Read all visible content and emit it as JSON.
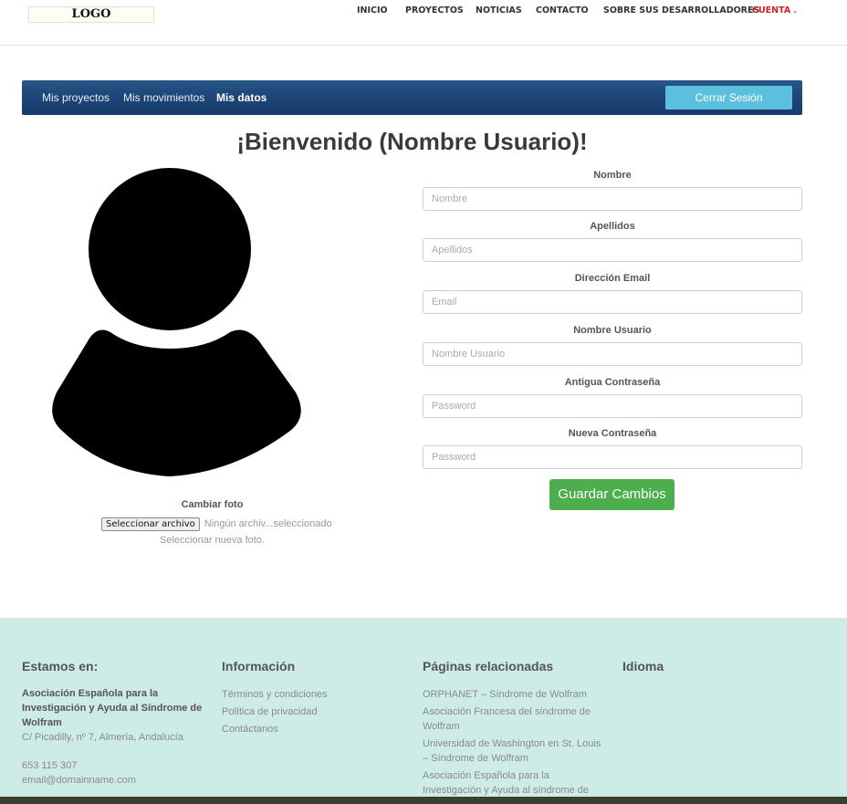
{
  "header": {
    "logo": "LOGO",
    "nav": [
      {
        "label": "INICIO",
        "active": false
      },
      {
        "label": "PROYECTOS",
        "active": false
      },
      {
        "label": "NOTICIAS",
        "active": false
      },
      {
        "label": "CONTACTO",
        "active": false
      },
      {
        "label": "SOBRE SUS DESARROLLADORES",
        "active": false
      },
      {
        "label": "CUENTA",
        "active": true
      }
    ]
  },
  "subnav": {
    "links": [
      "Mis proyectos",
      "Mis movimientos",
      "Mis datos"
    ],
    "current": "Mis datos",
    "logout": "Cerrar Sesión"
  },
  "welcome": "¡Bienvenido (Nombre Usuario)!",
  "photo": {
    "label": "Cambiar foto",
    "button": "Seleccionar archivo",
    "status": "Ningún archiv...seleccionado",
    "help": "Seleccionar nueva foto."
  },
  "form": {
    "fields": [
      {
        "label": "Nombre",
        "placeholder": "Nombre"
      },
      {
        "label": "Apellidos",
        "placeholder": "Apellidos"
      },
      {
        "label": "Dirección Email",
        "placeholder": "Email"
      },
      {
        "label": "Nombre Usuario",
        "placeholder": "Nombre Usuario"
      },
      {
        "label": "Antigua Contraseña",
        "placeholder": "Password"
      },
      {
        "label": "Nueva Contraseña",
        "placeholder": "Password"
      }
    ],
    "save": "Guardar Cambios"
  },
  "footer": {
    "location": {
      "heading": "Estamos en:",
      "org": "Asociación Española para la Investigación y Ayuda al Síndrome de Wolfram",
      "address": "C/ Picadilly, nº 7, Almería, Andalucía",
      "phone": "653 115 307",
      "email": "email@domainname.com"
    },
    "info": {
      "heading": "Información",
      "links": [
        "Términos y condiciones",
        "Política de privacidad",
        "Contáctanos"
      ]
    },
    "related": {
      "heading": "Páginas relacionadas",
      "links": [
        "ORPHANET – Síndrome de Wolfram",
        "Asociación Francesa del síndrome de Wolfram",
        "Universidad de Washington en St. Louis – Síndrome de Wolfram",
        "Asociación Española para la Investigación y Ayuda al síndrome de Wolfram"
      ]
    },
    "language": {
      "heading": "Idioma"
    }
  },
  "colors": {
    "accent_red": "#d3232a",
    "subnav_blue": "#1d4679",
    "logout_blue": "#5bc0de",
    "save_green": "#4cae4c",
    "footer_bg": "#cdece7"
  }
}
